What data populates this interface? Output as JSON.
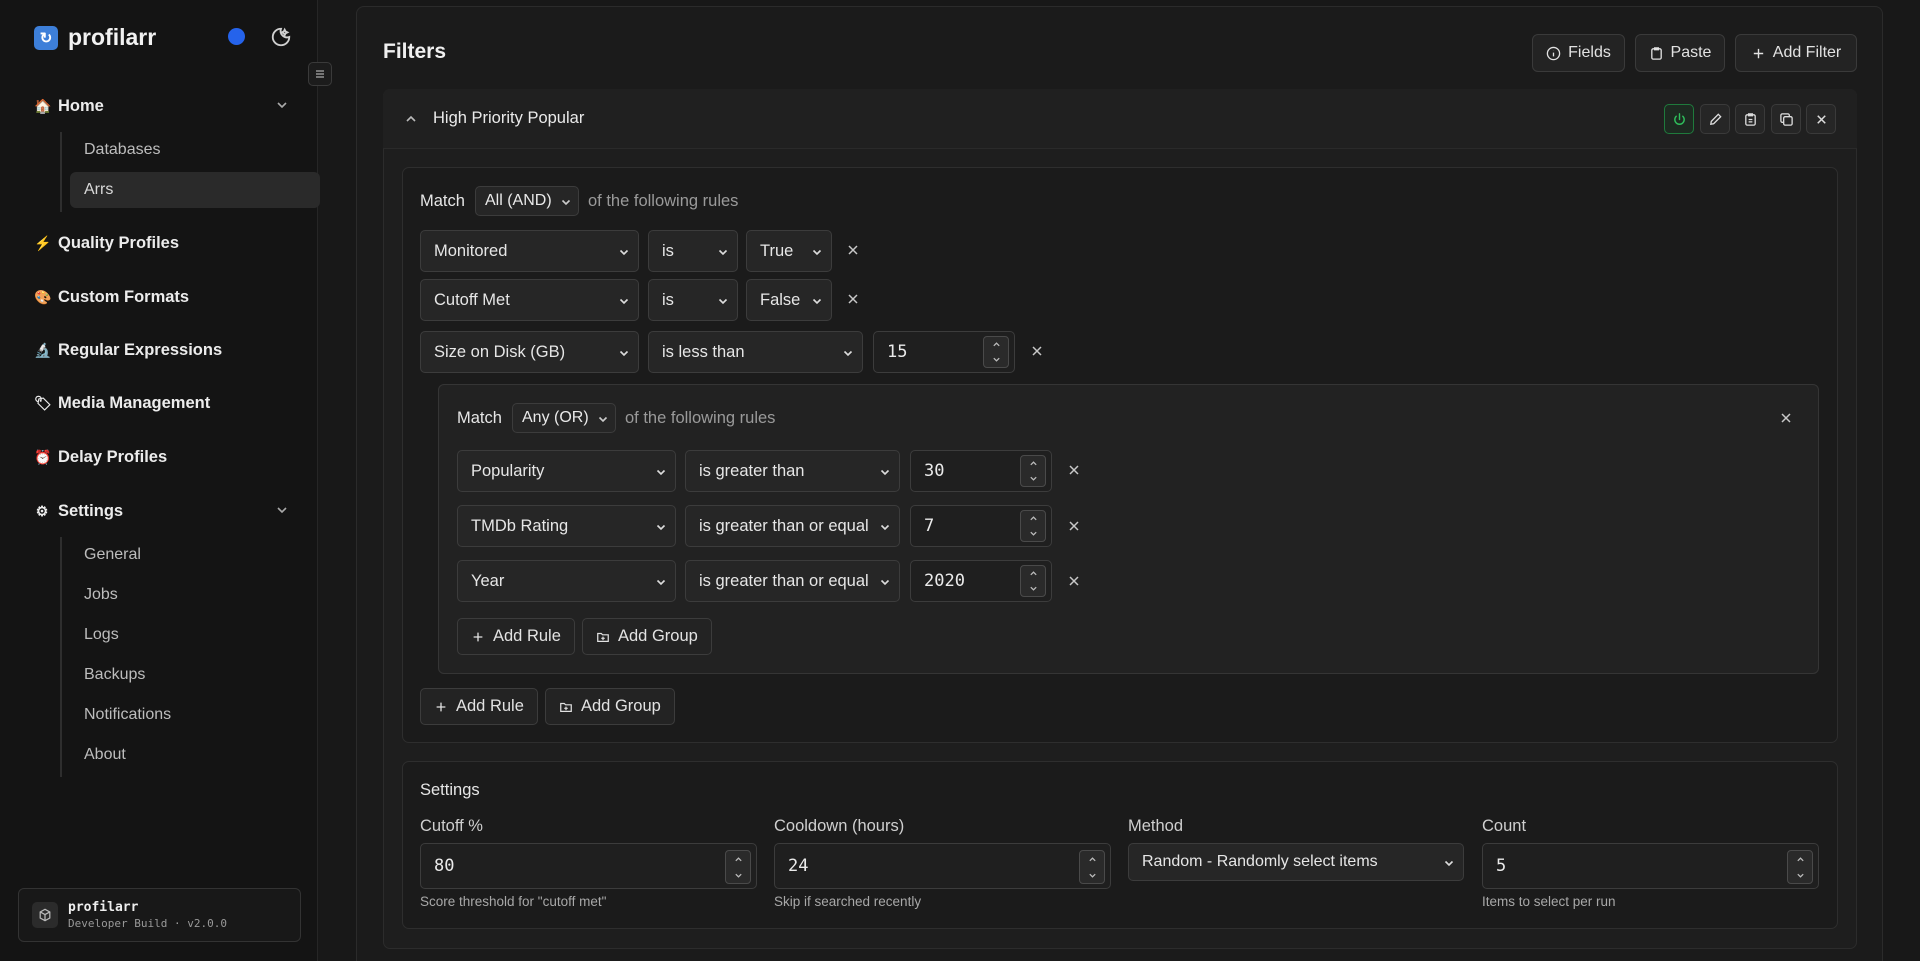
{
  "app": {
    "name": "profilarr",
    "status_color": "#2563eb"
  },
  "sidebar": {
    "items": [
      {
        "label": "Home",
        "icon": "house-icon",
        "expanded": true,
        "children": [
          "Databases",
          "Arrs"
        ],
        "active_child": "Arrs"
      },
      {
        "label": "Quality Profiles",
        "icon": "lightning-icon"
      },
      {
        "label": "Custom Formats",
        "icon": "palette-icon"
      },
      {
        "label": "Regular Expressions",
        "icon": "microscope-icon"
      },
      {
        "label": "Media Management",
        "icon": "tag-icon"
      },
      {
        "label": "Delay Profiles",
        "icon": "timer-icon"
      },
      {
        "label": "Settings",
        "icon": "gear-icon",
        "expanded": true,
        "children": [
          "General",
          "Jobs",
          "Logs",
          "Backups",
          "Notifications",
          "About"
        ]
      }
    ],
    "build": {
      "name": "profilarr",
      "version": "Developer Build · v2.0.0"
    }
  },
  "page": {
    "title": "Filters",
    "buttons": {
      "fields": "Fields",
      "paste": "Paste",
      "add_filter": "Add Filter"
    }
  },
  "filter": {
    "name": "High Priority Popular",
    "enabled": true,
    "group": {
      "match_label": "Match",
      "match_mode": "All (AND)",
      "suffix": "of the following rules",
      "rules": [
        {
          "field": "Monitored",
          "op": "is",
          "value": "True"
        },
        {
          "field": "Cutoff Met",
          "op": "is",
          "value": "False"
        },
        {
          "field": "Size on Disk (GB)",
          "op": "is less than",
          "value": "15"
        }
      ],
      "subgroup": {
        "match_label": "Match",
        "match_mode": "Any (OR)",
        "suffix": "of the following rules",
        "rules": [
          {
            "field": "Popularity",
            "op": "is greater than",
            "value": "30"
          },
          {
            "field": "TMDb Rating",
            "op": "is greater than or equal",
            "value": "7"
          },
          {
            "field": "Year",
            "op": "is greater than or equal",
            "value": "2020"
          }
        ],
        "add_rule": "Add Rule",
        "add_group": "Add Group"
      },
      "add_rule": "Add Rule",
      "add_group": "Add Group"
    },
    "settings": {
      "title": "Settings",
      "cutoff": {
        "label": "Cutoff %",
        "value": "80",
        "help": "Score threshold for \"cutoff met\""
      },
      "cooldown": {
        "label": "Cooldown (hours)",
        "value": "24",
        "help": "Skip if searched recently"
      },
      "method": {
        "label": "Method",
        "value": "Random - Randomly select items"
      },
      "count": {
        "label": "Count",
        "value": "5",
        "help": "Items to select per run"
      }
    }
  }
}
